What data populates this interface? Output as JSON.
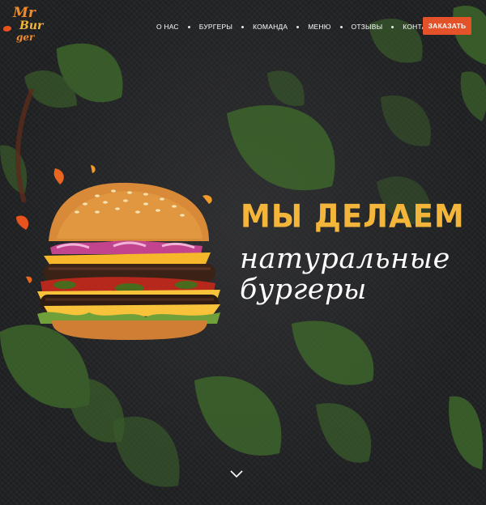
{
  "brand": {
    "logo_line1": "Mr",
    "logo_line2": "Bur",
    "logo_line3": "ger"
  },
  "nav": {
    "items": [
      "О НАС",
      "БУРГЕРЫ",
      "КОМАНДА",
      "МЕНЮ",
      "ОТЗЫВЫ",
      "КОНТАКТЫ"
    ],
    "order_label": "ЗАКАЗАТЬ"
  },
  "hero": {
    "line1": "МЫ ДЕЛАЕМ",
    "line2": "натуральные",
    "line3": "бургеры"
  },
  "colors": {
    "accent_orange": "#e4522a",
    "headline_yellow": "#f4b63a",
    "background": "#1e1f21"
  },
  "icons": {
    "scroll": "chevron-down-icon"
  }
}
